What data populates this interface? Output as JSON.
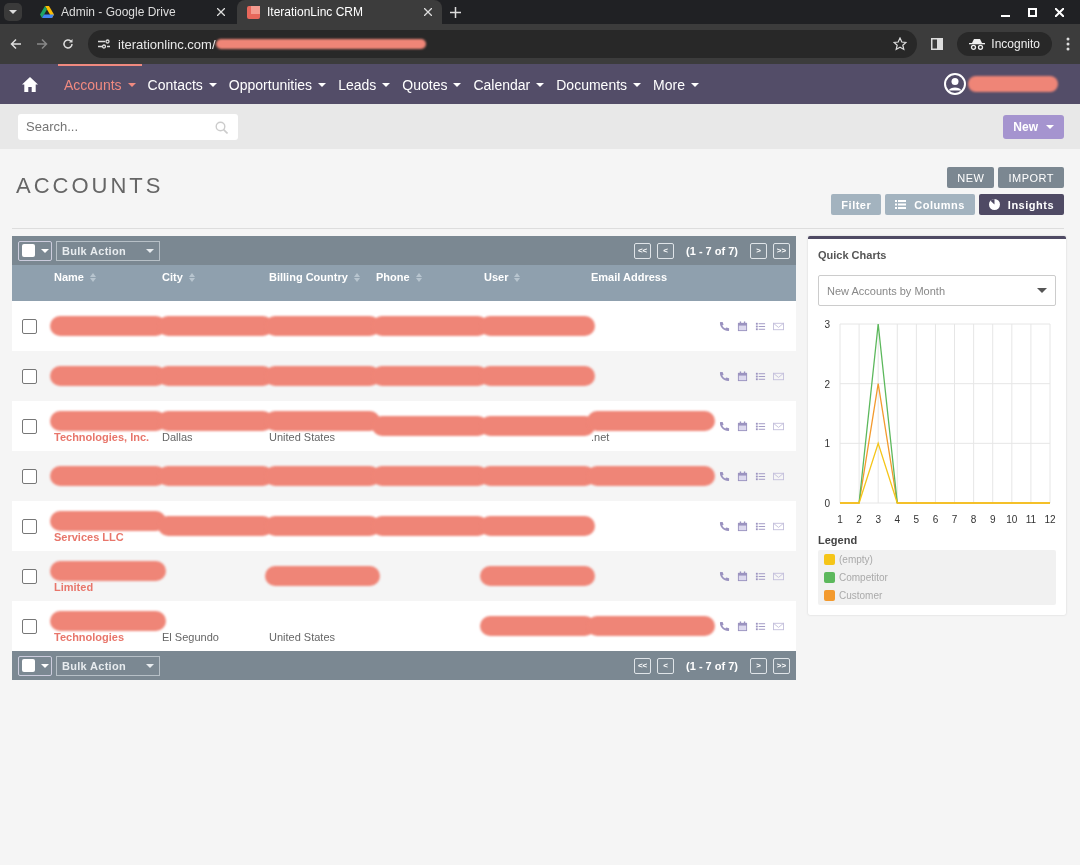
{
  "browser": {
    "tabs": [
      {
        "title": "Admin - Google Drive",
        "selected": false
      },
      {
        "title": "IterationLinc CRM",
        "selected": true
      }
    ],
    "url": "iterationlinc.com/",
    "profile": "Incognito"
  },
  "nav": {
    "items": [
      {
        "label": "Accounts",
        "selected": true
      },
      {
        "label": "Contacts",
        "selected": false
      },
      {
        "label": "Opportunities",
        "selected": false
      },
      {
        "label": "Leads",
        "selected": false
      },
      {
        "label": "Quotes",
        "selected": false
      },
      {
        "label": "Calendar",
        "selected": false
      },
      {
        "label": "Documents",
        "selected": false
      },
      {
        "label": "More",
        "selected": false
      }
    ]
  },
  "search": {
    "placeholder": "Search..."
  },
  "new_menu": "New",
  "page_title": "ACCOUNTS",
  "actions": [
    {
      "label": "NEW",
      "kind": "dark"
    },
    {
      "label": "IMPORT",
      "kind": "dark"
    }
  ],
  "view_buttons": [
    {
      "label": "Filter",
      "kind": "plain",
      "selected": false
    },
    {
      "label": "Columns",
      "kind": "columns",
      "selected": false
    },
    {
      "label": "Insights",
      "kind": "insights",
      "selected": true
    }
  ],
  "table": {
    "toolbars": [
      {
        "select_all_checked": false,
        "bulk_action": "Bulk Action",
        "pagination": "(1 - 7 of 7)",
        "pager": [
          "<<",
          "<",
          ">",
          ">>"
        ]
      },
      {
        "select_all_checked": false,
        "bulk_action": "Bulk Action",
        "pagination": "(1 - 7 of 7)",
        "pager": [
          "<<",
          "<",
          ">",
          ">>"
        ]
      }
    ],
    "columns": [
      {
        "label": "Name",
        "sortable": true
      },
      {
        "label": "City",
        "sortable": true
      },
      {
        "label": "Billing Country",
        "sortable": true
      },
      {
        "label": "Phone",
        "sortable": true
      },
      {
        "label": "User",
        "sortable": true
      },
      {
        "label": "Email Address",
        "sortable": false
      }
    ],
    "rows": [
      {
        "checked": false,
        "cells": [
          {
            "redacted": true
          },
          {
            "redacted": true
          },
          {
            "redacted": true
          },
          {
            "redacted": true
          },
          {
            "redacted": true
          },
          {
            "redacted": false
          }
        ]
      },
      {
        "checked": false,
        "cells": [
          {
            "redacted": true
          },
          {
            "redacted": true
          },
          {
            "redacted": true
          },
          {
            "redacted": true
          },
          {
            "redacted": true
          },
          {
            "redacted": false
          }
        ]
      },
      {
        "checked": false,
        "cells": [
          {
            "text": "Technologies, Inc.",
            "redacted": true
          },
          {
            "text": "Dallas",
            "redacted": true
          },
          {
            "text": "United States",
            "redacted": true
          },
          {
            "redacted": true
          },
          {
            "redacted": true
          },
          {
            "text": ".net",
            "redacted": true
          }
        ]
      },
      {
        "checked": false,
        "cells": [
          {
            "redacted": true
          },
          {
            "redacted": true
          },
          {
            "redacted": true
          },
          {
            "redacted": true
          },
          {
            "redacted": true
          },
          {
            "redacted": true
          }
        ]
      },
      {
        "checked": false,
        "cells": [
          {
            "text": "Services LLC",
            "redacted": true
          },
          {
            "redacted": true
          },
          {
            "redacted": true
          },
          {
            "redacted": true
          },
          {
            "redacted": true
          },
          {
            "redacted": false
          }
        ]
      },
      {
        "checked": false,
        "cells": [
          {
            "text": "Limited",
            "redacted": true
          },
          {
            "redacted": false
          },
          {
            "redacted": true
          },
          {
            "redacted": false
          },
          {
            "redacted": true
          },
          {
            "redacted": false
          }
        ]
      },
      {
        "checked": false,
        "cells": [
          {
            "text": "Technologies",
            "redacted": true
          },
          {
            "text": "El Segundo",
            "redacted": false
          },
          {
            "text": "United States",
            "redacted": false
          },
          {
            "redacted": false
          },
          {
            "redacted": true
          },
          {
            "redacted": true
          }
        ]
      }
    ]
  },
  "quick_charts": {
    "title": "Quick Charts",
    "selector": "New Accounts by Month",
    "chart_data": {
      "type": "line",
      "x": [
        1,
        2,
        3,
        4,
        5,
        6,
        7,
        8,
        9,
        10,
        11,
        12
      ],
      "yticks": [
        0,
        1,
        2,
        3
      ],
      "ylim": [
        0,
        3
      ],
      "grid": true,
      "series": [
        {
          "name": "(empty)",
          "color": "#f5c518",
          "values": [
            0,
            0,
            1,
            0,
            0,
            0,
            0,
            0,
            0,
            0,
            0,
            0
          ]
        },
        {
          "name": "Competitor",
          "color": "#5cb85c",
          "values": [
            null,
            0,
            3,
            0,
            null,
            null,
            null,
            null,
            null,
            null,
            null,
            null
          ]
        },
        {
          "name": "Customer",
          "color": "#f39a2e",
          "values": [
            0,
            0,
            2,
            0,
            0,
            0,
            0,
            0,
            0,
            0,
            0,
            0
          ]
        }
      ]
    },
    "legend_title": "Legend"
  }
}
